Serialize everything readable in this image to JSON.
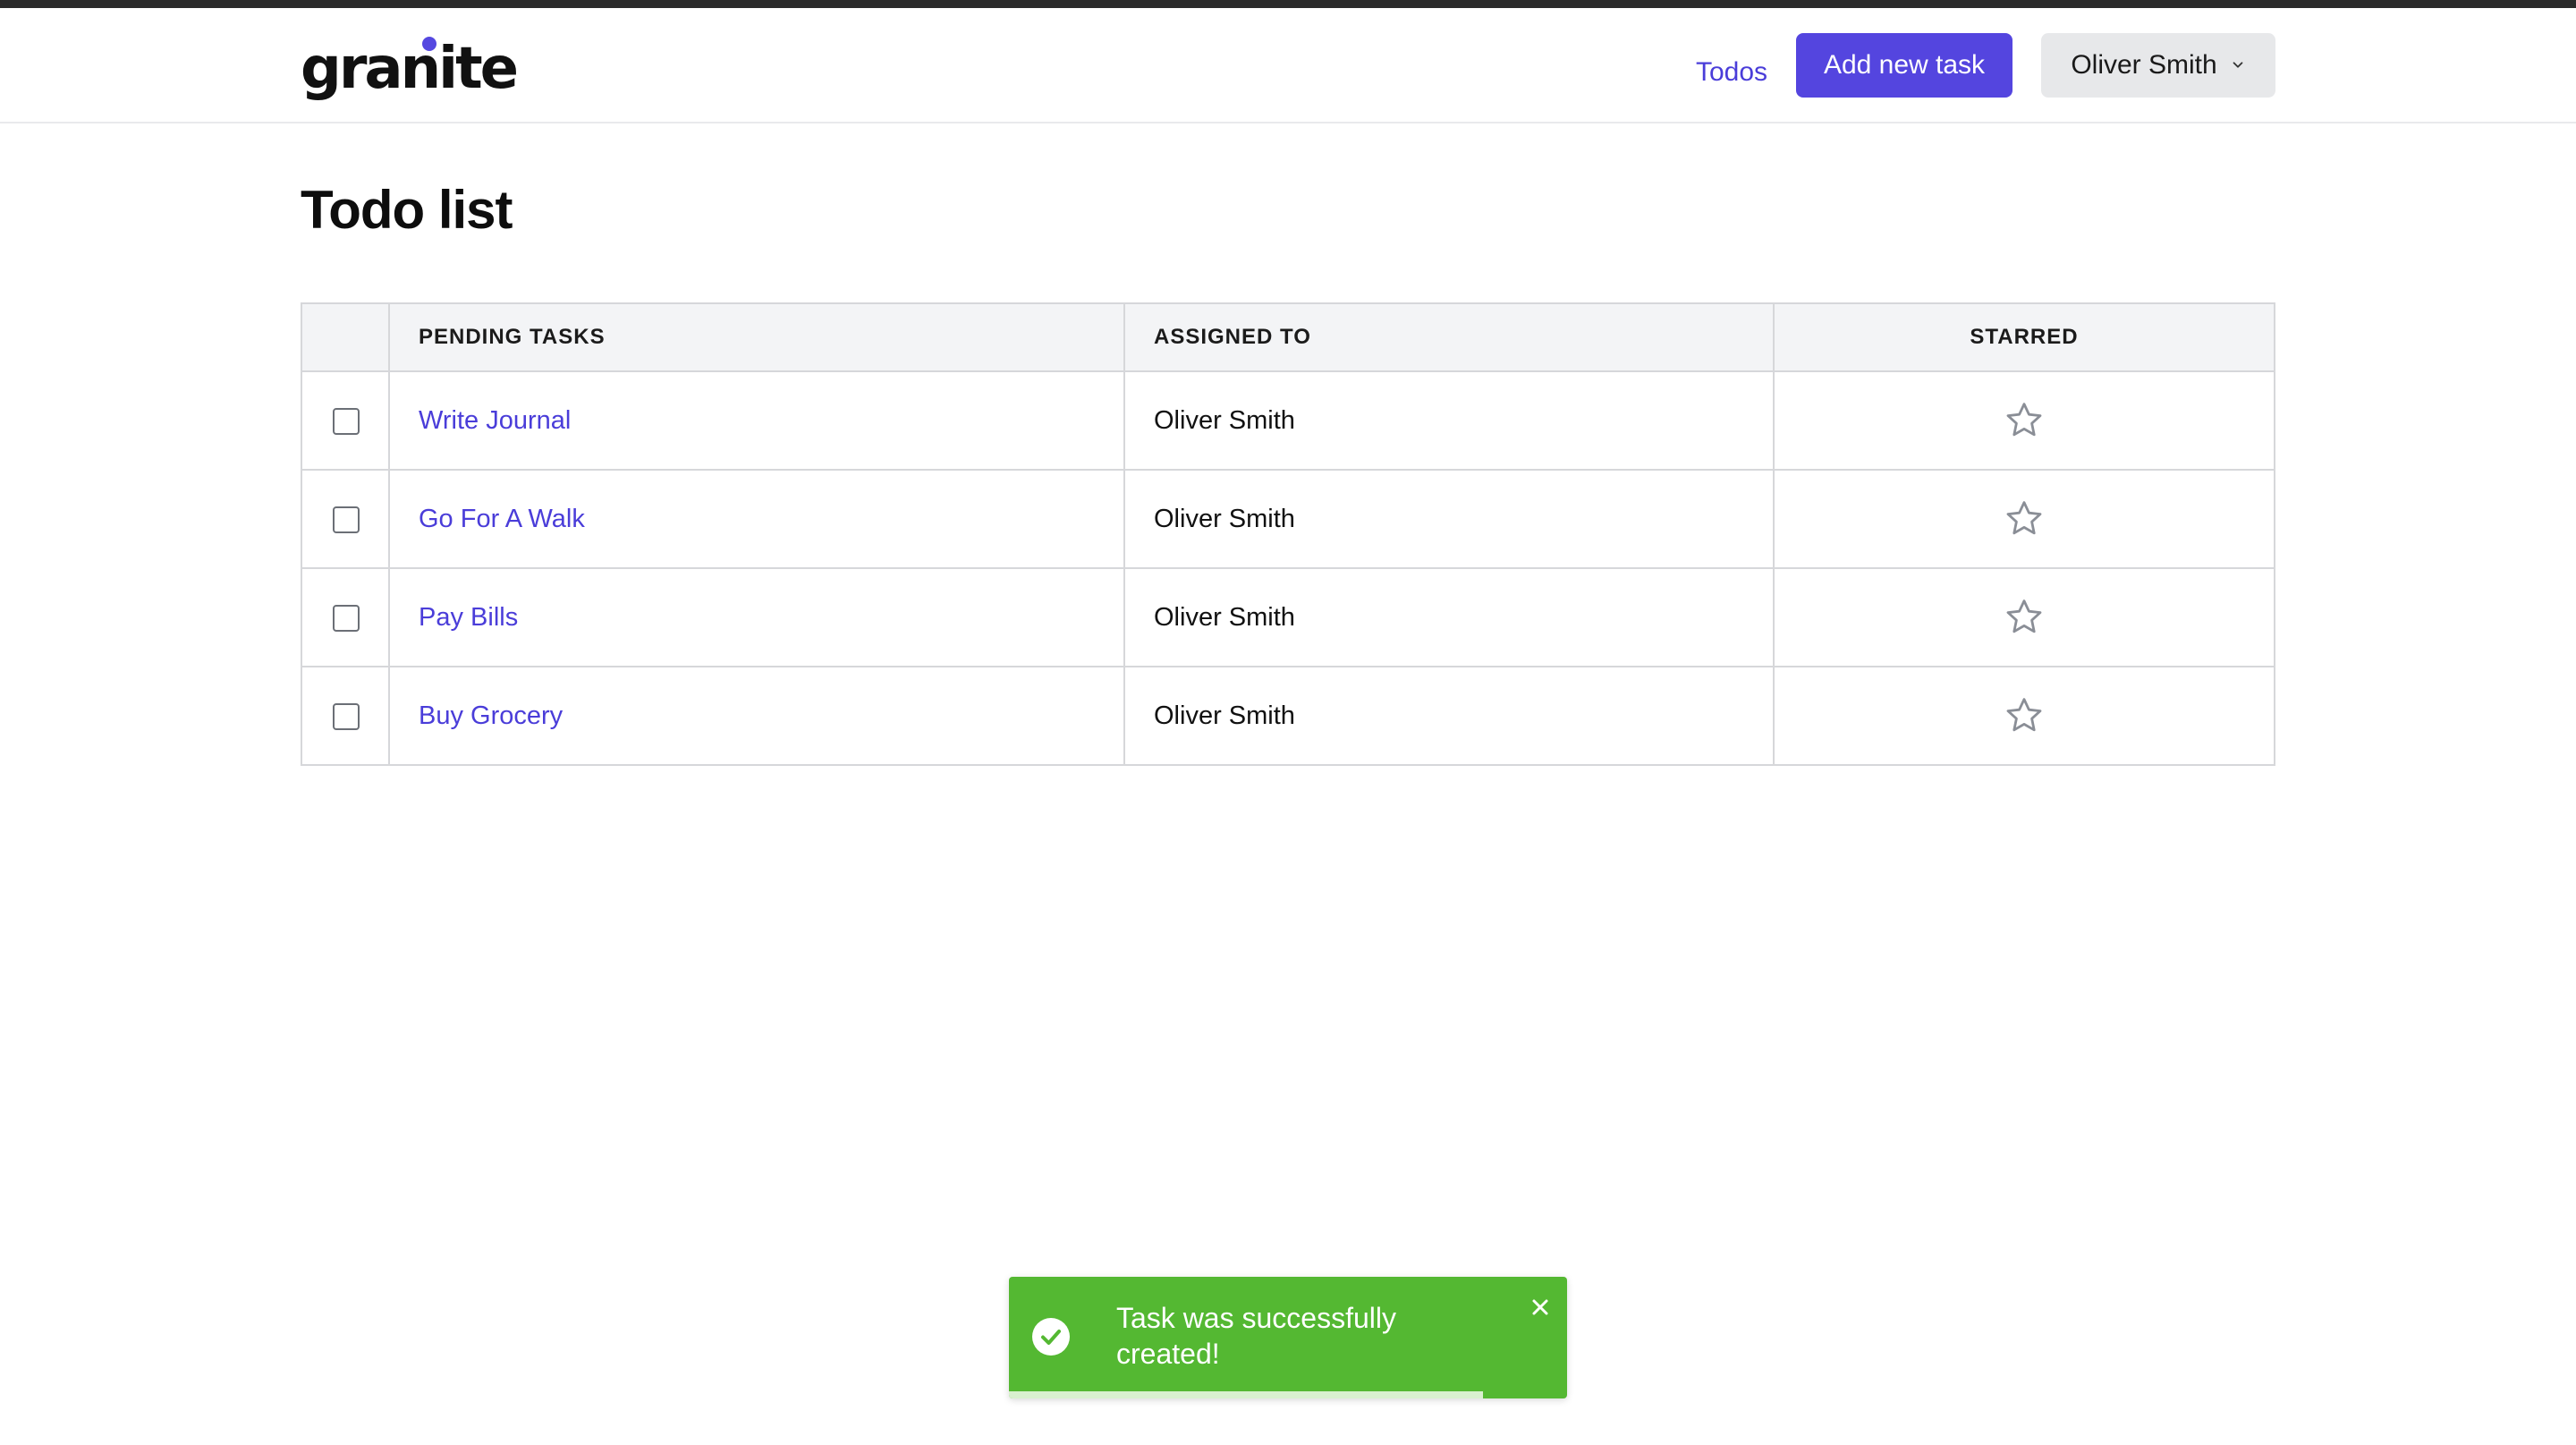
{
  "brand": {
    "logo_text": "granite",
    "accent_color": "#5445df"
  },
  "nav": {
    "todos_link": "Todos",
    "add_task_label": "Add new task",
    "user_name": "Oliver Smith"
  },
  "page": {
    "title": "Todo list"
  },
  "table": {
    "headers": {
      "tasks": "PENDING TASKS",
      "assigned": "ASSIGNED TO",
      "starred": "STARRED"
    },
    "rows": [
      {
        "title": "Write Journal",
        "assigned_to": "Oliver Smith",
        "starred": false,
        "done": false
      },
      {
        "title": "Go For A Walk",
        "assigned_to": "Oliver Smith",
        "starred": false,
        "done": false
      },
      {
        "title": "Pay Bills",
        "assigned_to": "Oliver Smith",
        "starred": false,
        "done": false
      },
      {
        "title": "Buy Grocery",
        "assigned_to": "Oliver Smith",
        "starred": false,
        "done": false
      }
    ]
  },
  "toast": {
    "message": "Task was successfully created!",
    "status": "success",
    "color": "#54b832",
    "icon": "check-circle-icon",
    "progress_fraction": 0.85
  }
}
